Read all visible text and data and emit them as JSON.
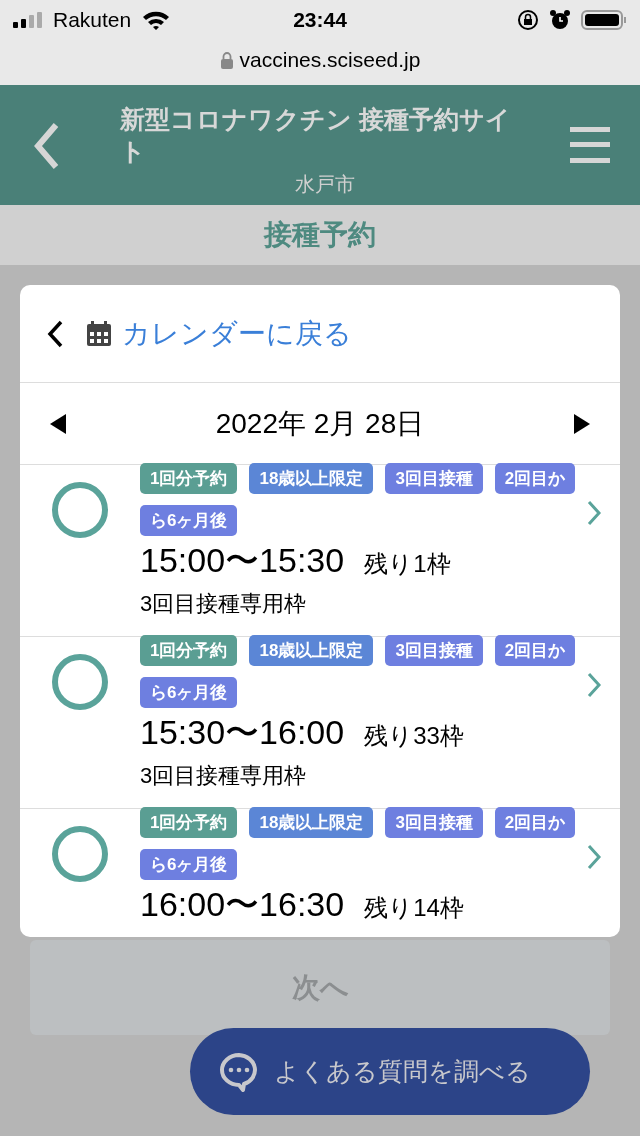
{
  "status_bar": {
    "carrier": "Rakuten",
    "time": "23:44"
  },
  "browser": {
    "url": "vaccines.sciseed.jp"
  },
  "header": {
    "title": "新型コロナワクチン 接種予約サイト",
    "subtitle": "水戸市"
  },
  "section_title": "接種予約",
  "modal": {
    "back_label": "カレンダーに戻る",
    "date": "2022年 2月 28日",
    "slots": [
      {
        "tags": [
          {
            "label": "1回分予約",
            "color": "#5a9e93"
          },
          {
            "label": "18歳以上限定",
            "color": "#5b86d6"
          },
          {
            "label": "3回目接種",
            "color": "#6e7fe0"
          },
          {
            "label": "2回目から6ヶ月後",
            "color": "#6e7fe0"
          }
        ],
        "time": "15:00〜15:30",
        "remaining": "残り1枠",
        "note": "3回目接種専用枠"
      },
      {
        "tags": [
          {
            "label": "1回分予約",
            "color": "#5a9e93"
          },
          {
            "label": "18歳以上限定",
            "color": "#5b86d6"
          },
          {
            "label": "3回目接種",
            "color": "#6e7fe0"
          },
          {
            "label": "2回目から6ヶ月後",
            "color": "#6e7fe0"
          }
        ],
        "time": "15:30〜16:00",
        "remaining": "残り33枠",
        "note": "3回目接種専用枠"
      },
      {
        "tags": [
          {
            "label": "1回分予約",
            "color": "#5a9e93"
          },
          {
            "label": "18歳以上限定",
            "color": "#5b86d6"
          },
          {
            "label": "3回目接種",
            "color": "#6e7fe0"
          },
          {
            "label": "2回目から6ヶ月後",
            "color": "#6e7fe0"
          }
        ],
        "time": "16:00〜16:30",
        "remaining": "残り14枠"
      }
    ]
  },
  "next_button": {
    "label": "次へ",
    "disabled": true
  },
  "faq_button": "よくある質問を調べる"
}
